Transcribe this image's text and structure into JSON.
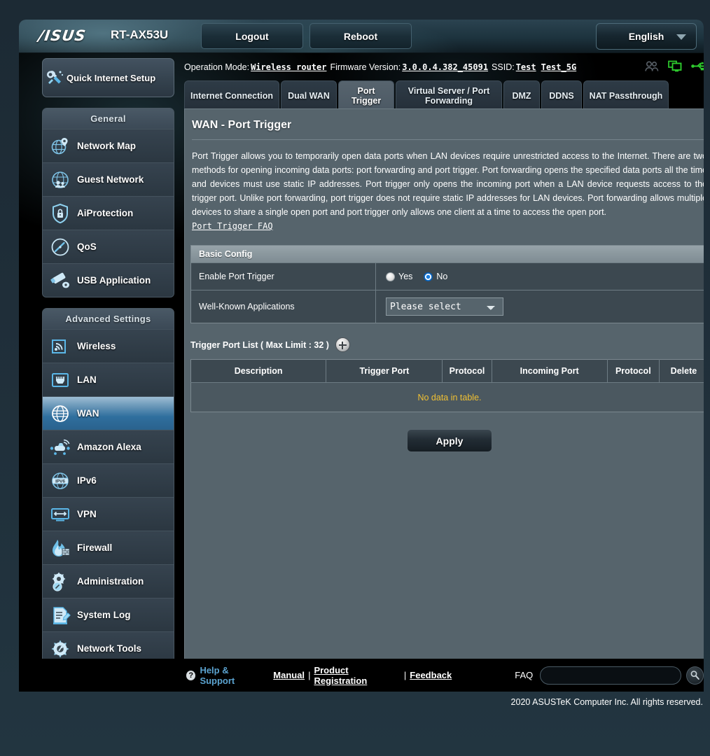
{
  "header": {
    "brand": "/ISUS",
    "model": "RT-AX53U",
    "logout_label": "Logout",
    "reboot_label": "Reboot",
    "language": "English"
  },
  "infobar": {
    "operation_mode_label": "Operation Mode:",
    "operation_mode_value": "Wireless router",
    "firmware_label": "Firmware Version:",
    "firmware_value": "3.0.0.4.382_45091",
    "ssid_label": "SSID:",
    "ssid_24": "Test",
    "ssid_5g": "Test_5G",
    "icons": [
      "clients-icon",
      "usb-monitor-icon",
      "usb-icon"
    ]
  },
  "sidebar": {
    "quick_setup": "Quick Internet Setup",
    "groups": [
      {
        "title": "General",
        "items": [
          {
            "label": "Network Map",
            "icon": "network-map-icon",
            "active": false
          },
          {
            "label": "Guest Network",
            "icon": "guest-network-icon",
            "active": false
          },
          {
            "label": "AiProtection",
            "icon": "shield-lock-icon",
            "active": false
          },
          {
            "label": "QoS",
            "icon": "gauge-icon",
            "active": false
          },
          {
            "label": "USB Application",
            "icon": "usb-application-icon",
            "active": false
          }
        ]
      },
      {
        "title": "Advanced Settings",
        "items": [
          {
            "label": "Wireless",
            "icon": "wireless-icon",
            "active": false
          },
          {
            "label": "LAN",
            "icon": "lan-port-icon",
            "active": false
          },
          {
            "label": "WAN",
            "icon": "globe-icon",
            "active": true
          },
          {
            "label": "Amazon Alexa",
            "icon": "alexa-icon",
            "active": false
          },
          {
            "label": "IPv6",
            "icon": "ipv6-icon",
            "active": false
          },
          {
            "label": "VPN",
            "icon": "vpn-icon",
            "active": false
          },
          {
            "label": "Firewall",
            "icon": "firewall-flame-icon",
            "active": false
          },
          {
            "label": "Administration",
            "icon": "gear-admin-icon",
            "active": false
          },
          {
            "label": "System Log",
            "icon": "system-log-icon",
            "active": false
          },
          {
            "label": "Network Tools",
            "icon": "network-tools-icon",
            "active": false
          }
        ]
      }
    ]
  },
  "tabs": [
    {
      "label": "Internet Connection",
      "active": false
    },
    {
      "label": "Dual WAN",
      "active": false
    },
    {
      "label": "Port Trigger",
      "active": true
    },
    {
      "label": "Virtual Server / Port Forwarding",
      "active": false
    },
    {
      "label": "DMZ",
      "active": false
    },
    {
      "label": "DDNS",
      "active": false
    },
    {
      "label": "NAT Passthrough",
      "active": false
    }
  ],
  "page": {
    "title": "WAN - Port Trigger",
    "description": "Port Trigger allows you to temporarily open data ports when LAN devices require unrestricted access to the Internet. There are two methods for opening incoming data ports: port forwarding and port trigger. Port forwarding opens the specified data ports all the time and devices must use static IP addresses. Port trigger only opens the incoming port when a LAN device requests access to the trigger port. Unlike port forwarding, port trigger does not require static IP addresses for LAN devices. Port forwarding allows multiple devices to share a single open port and port trigger only allows one client at a time to access the open port.",
    "faq_link": "Port Trigger FAQ"
  },
  "basic_config": {
    "section_title": "Basic Config",
    "enable_label": "Enable Port Trigger",
    "radio_yes": "Yes",
    "radio_no": "No",
    "selected": "No",
    "wka_label": "Well-Known Applications",
    "wka_value": "Please select",
    "wka_options": [
      "Please select"
    ]
  },
  "trigger_list": {
    "heading": "Trigger Port List ( Max Limit : 32 )",
    "add_icon": "plus-circle-icon",
    "columns": [
      "Description",
      "Trigger Port",
      "Protocol",
      "Incoming Port",
      "Protocol",
      "Delete"
    ],
    "rows": [],
    "empty_text": "No data in table.",
    "apply_label": "Apply"
  },
  "footer": {
    "help_icon": "question-mark-icon",
    "help_label": "Help & Support",
    "manual": "Manual",
    "sep": "|",
    "product_registration": "Product Registration",
    "feedback": "Feedback",
    "faq_label": "FAQ",
    "faq_placeholder": "",
    "faq_value": "",
    "search_icon": "search-icon",
    "copyright": "2020 ASUSTeK Computer Inc. All rights reserved."
  },
  "colors": {
    "accent_blue": "#2f6f9e",
    "warning_yellow": "#f0c033",
    "link_blue": "#5ba3d0",
    "panel_bg": "#56646c"
  }
}
